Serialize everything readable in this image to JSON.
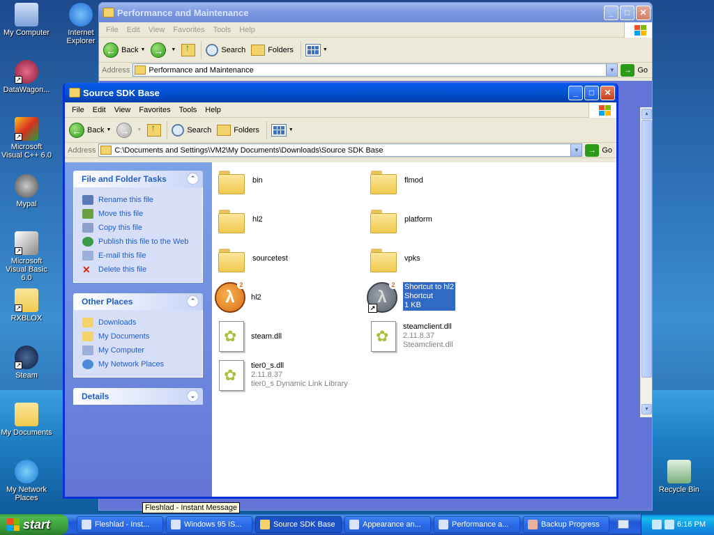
{
  "desktop": {
    "icons": [
      {
        "label": "My Computer"
      },
      {
        "label": "Internet Explorer"
      },
      {
        "label": "DataWagon..."
      },
      {
        "label": "Microsoft Visual C++ 6.0"
      },
      {
        "label": "Mypal"
      },
      {
        "label": "Microsoft Visual Basic 6.0"
      },
      {
        "label": "RXBLOX"
      },
      {
        "label": "Steam"
      },
      {
        "label": "My Documents"
      },
      {
        "label": "My Network Places"
      },
      {
        "label": "Recycle Bin"
      }
    ]
  },
  "back_window": {
    "title": "Performance and Maintenance",
    "menu": [
      "File",
      "Edit",
      "View",
      "Favorites",
      "Tools",
      "Help"
    ],
    "toolbar": {
      "back": "Back",
      "search": "Search",
      "folders": "Folders"
    },
    "address_label": "Address",
    "address_value": "Performance and Maintenance",
    "go": "Go"
  },
  "front_window": {
    "title": "Source SDK Base",
    "menu": [
      "File",
      "Edit",
      "View",
      "Favorites",
      "Tools",
      "Help"
    ],
    "toolbar": {
      "back": "Back",
      "search": "Search",
      "folders": "Folders"
    },
    "address_label": "Address",
    "address_value": "C:\\Documents and Settings\\VM2\\My Documents\\Downloads\\Source SDK Base",
    "go": "Go"
  },
  "sidebar": {
    "file_tasks": {
      "title": "File and Folder Tasks",
      "items": [
        {
          "label": "Rename this file",
          "color": "#5a7ab8"
        },
        {
          "label": "Move this file",
          "color": "#6aa040"
        },
        {
          "label": "Copy this file",
          "color": "#8aa0c8"
        },
        {
          "label": "Publish this file to the Web",
          "color": "#3a9a4a"
        },
        {
          "label": "E-mail this file",
          "color": "#9ab0d8"
        },
        {
          "label": "Delete this file",
          "color": "#d02818"
        }
      ]
    },
    "other_places": {
      "title": "Other Places",
      "items": [
        {
          "label": "Downloads",
          "color": "#f3d46c"
        },
        {
          "label": "My Documents",
          "color": "#f3d46c"
        },
        {
          "label": "My Computer",
          "color": "#9ab0d8"
        },
        {
          "label": "My Network Places",
          "color": "#4a8ad8"
        }
      ]
    },
    "details": {
      "title": "Details"
    }
  },
  "files": [
    {
      "name": "bin",
      "kind": "folder"
    },
    {
      "name": "flmod",
      "kind": "folder"
    },
    {
      "name": "hl2",
      "kind": "folder"
    },
    {
      "name": "platform",
      "kind": "folder"
    },
    {
      "name": "sourcetest",
      "kind": "folder"
    },
    {
      "name": "vpks",
      "kind": "folder"
    },
    {
      "name": "hl2",
      "kind": "app"
    },
    {
      "name": "Shortcut to hl2",
      "line2": "Shortcut",
      "line3": "1 KB",
      "kind": "shortcut",
      "selected": true
    },
    {
      "name": "steam.dll",
      "kind": "dll"
    },
    {
      "name": "steamclient.dll",
      "line2": "2.11.8.37",
      "line3": "Steamclient.dll",
      "kind": "dll"
    },
    {
      "name": "tier0_s.dll",
      "line2": "2.11.8.37",
      "line3": "tier0_s Dynamic Link Library",
      "kind": "dll"
    }
  ],
  "tooltip": "Fleshlad - Instant Message",
  "taskbar": {
    "start": "start",
    "tasks": [
      {
        "label": "Fleshlad - Inst...",
        "active": false
      },
      {
        "label": "Windows 95 IS...",
        "active": false
      },
      {
        "label": "Source SDK Base",
        "active": true
      },
      {
        "label": "Appearance an...",
        "active": false
      },
      {
        "label": "Performance a...",
        "active": false
      },
      {
        "label": "Backup Progress",
        "active": false
      }
    ],
    "clock": "6:16 PM"
  },
  "colors": {
    "title_active": "#0453d2",
    "selection": "#316ac5",
    "task_link": "#215dc6"
  }
}
